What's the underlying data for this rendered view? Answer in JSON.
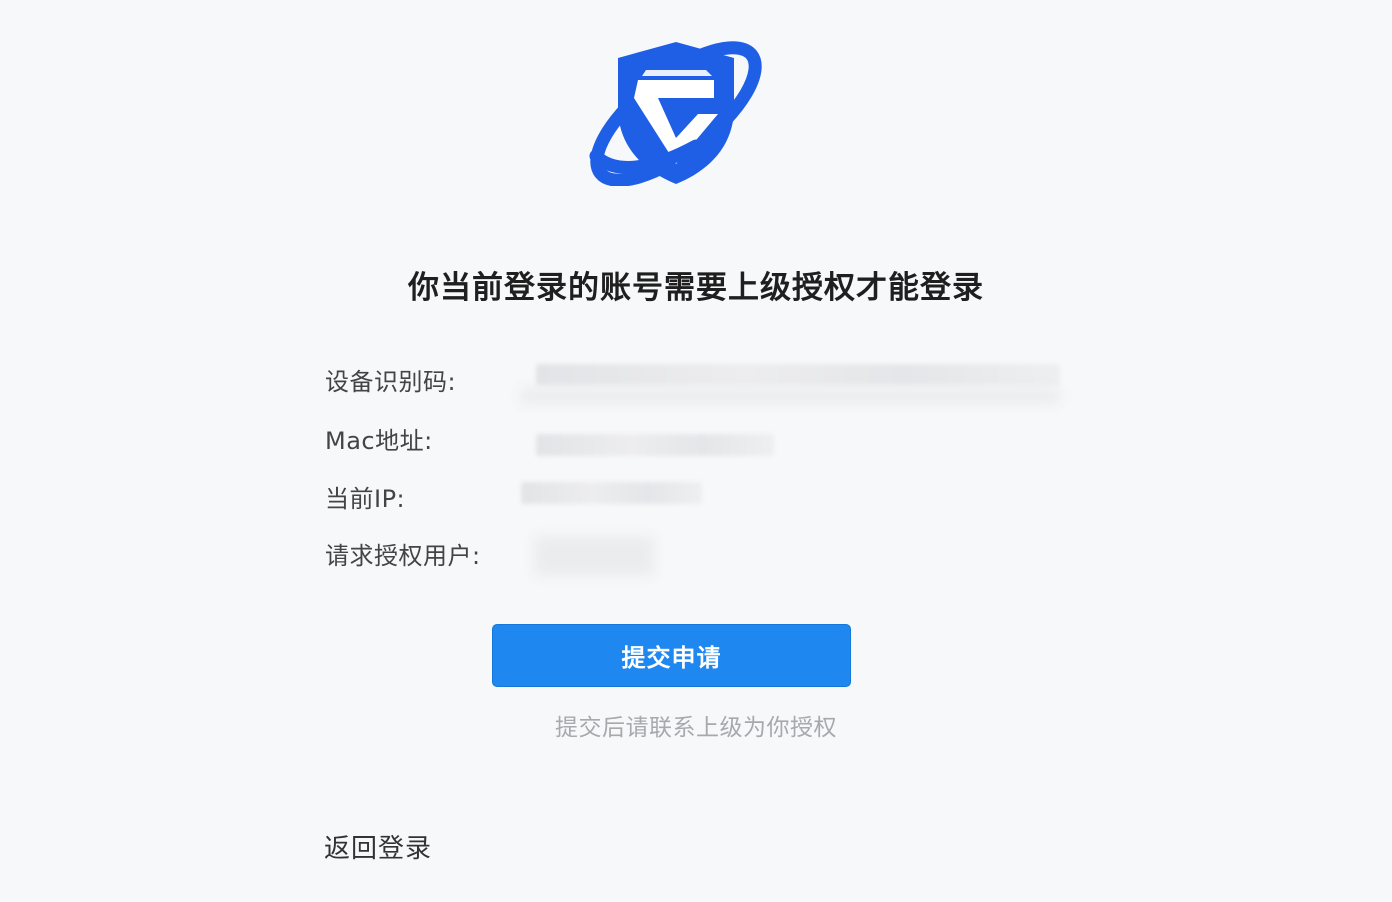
{
  "logo": {
    "icon": "shield-logo-icon",
    "brand_color": "#1e5fe6"
  },
  "title": "你当前登录的账号需要上级授权才能登录",
  "fields": [
    {
      "label": "设备识别码:",
      "value": ""
    },
    {
      "label": "Mac地址:",
      "value": ""
    },
    {
      "label": "当前IP:",
      "value": ""
    },
    {
      "label": "请求授权用户:",
      "value": ""
    }
  ],
  "submit": {
    "label": "提交申请",
    "color": "#1e88f0"
  },
  "hint": "提交后请联系上级为你授权",
  "back": {
    "label": "返回登录"
  }
}
